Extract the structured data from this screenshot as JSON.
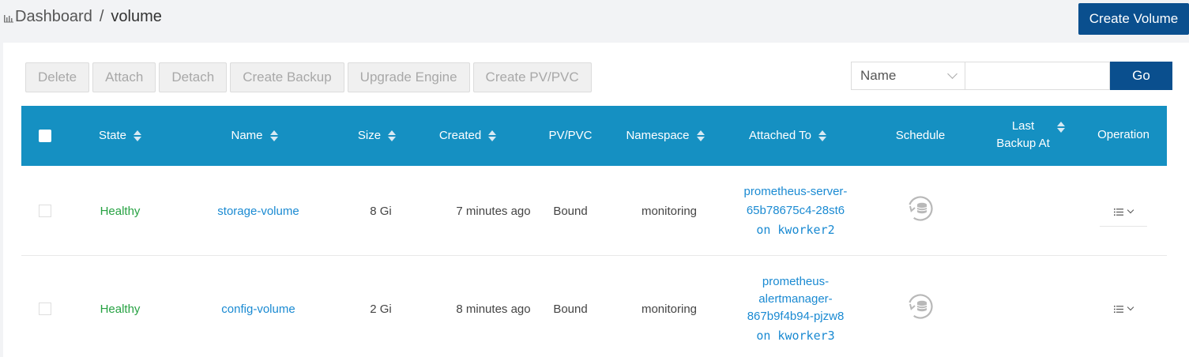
{
  "breadcrumb": {
    "root": "Dashboard",
    "separator": "/",
    "current": "volume"
  },
  "header": {
    "create_volume_label": "Create Volume"
  },
  "actions": [
    "Delete",
    "Attach",
    "Detach",
    "Create Backup",
    "Upgrade Engine",
    "Create PV/PVC"
  ],
  "search": {
    "field_selected": "Name",
    "value": "",
    "go_label": "Go"
  },
  "table": {
    "columns": {
      "state": "State",
      "name": "Name",
      "size": "Size",
      "created": "Created",
      "pvpvc": "PV/PVC",
      "namespace": "Namespace",
      "attached_to": "Attached To",
      "schedule": "Schedule",
      "last_backup_line1": "Last",
      "last_backup_line2": "Backup At",
      "operation": "Operation"
    },
    "rows": [
      {
        "state": "Healthy",
        "name": "storage-volume",
        "size": "8 Gi",
        "created": "7 minutes ago",
        "pvpvc": "Bound",
        "namespace": "monitoring",
        "attached_lines": [
          "prometheus-server-",
          "65b78675c4-28st6"
        ],
        "attached_node": "on kworker2",
        "last_backup": ""
      },
      {
        "state": "Healthy",
        "name": "config-volume",
        "size": "2 Gi",
        "created": "8 minutes ago",
        "pvpvc": "Bound",
        "namespace": "monitoring",
        "attached_lines": [
          "prometheus-",
          "alertmanager-",
          "867b9f4b94-pjzw8"
        ],
        "attached_node": "on kworker3",
        "last_backup": ""
      }
    ]
  },
  "colors": {
    "primary": "#0a4f8e",
    "header_bg": "#1590c2",
    "healthy": "#27a243",
    "link": "#1a8ad2"
  },
  "icons": [
    "bar-chart-icon",
    "sort-icon",
    "schedule-backup-icon",
    "list-icon",
    "chevron-down-icon"
  ]
}
